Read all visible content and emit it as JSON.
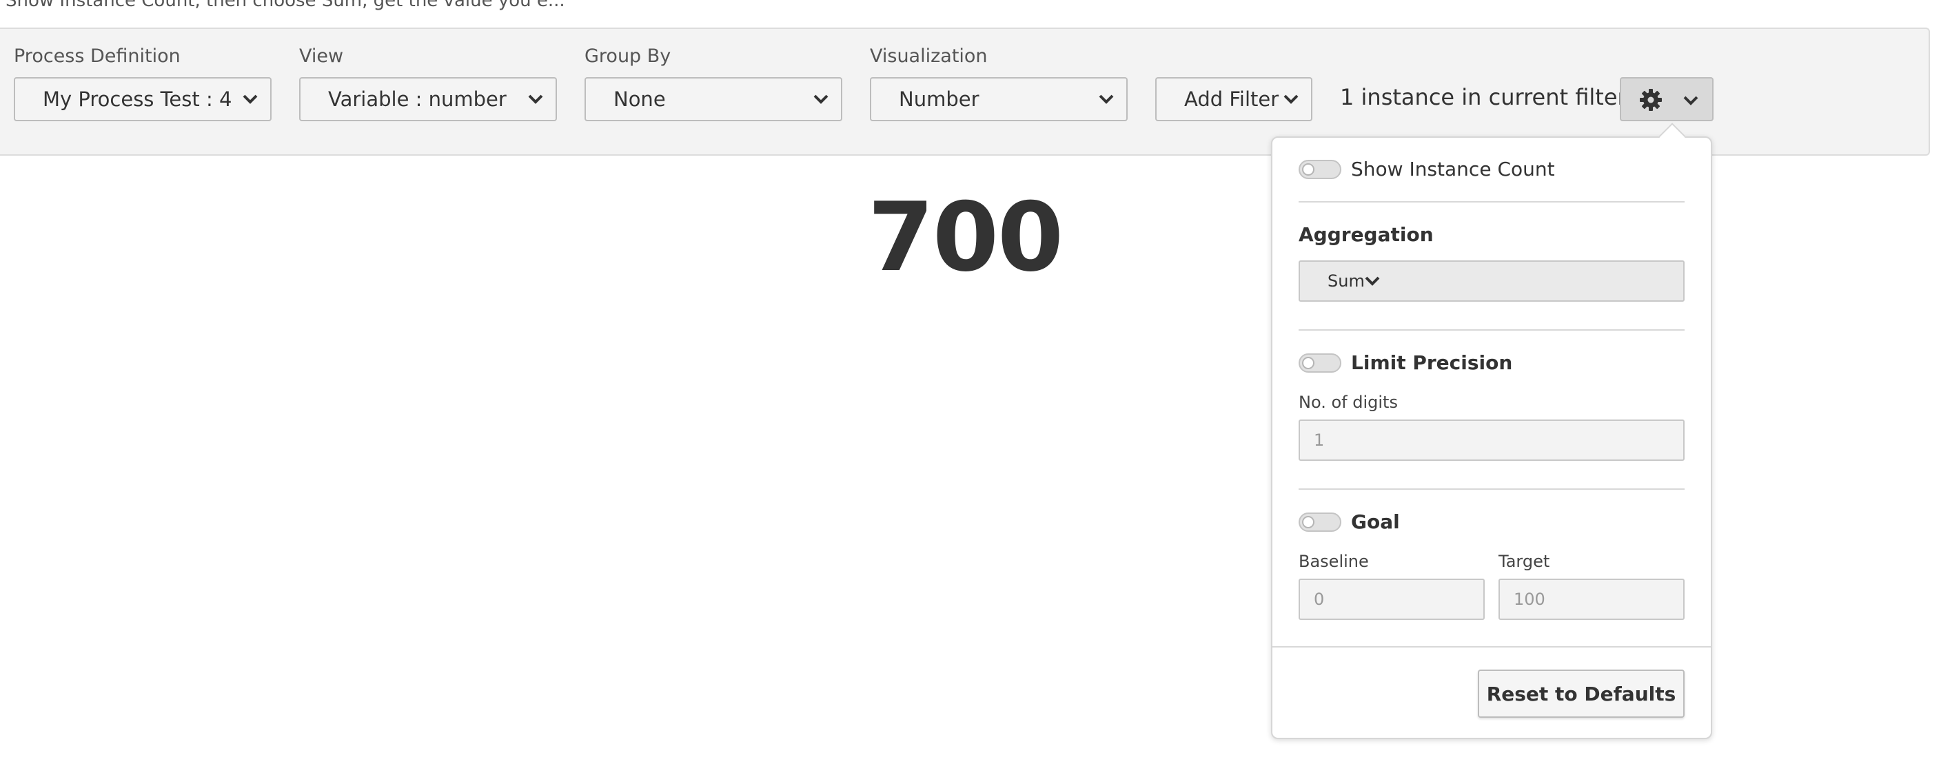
{
  "header": {
    "cutoff_text": "Show Instance Count, then choose Sum, get the value you e..."
  },
  "controls": {
    "process_definition": {
      "label": "Process Definition",
      "value": "My Process Test : 4"
    },
    "view": {
      "label": "View",
      "value": "Variable : number"
    },
    "group_by": {
      "label": "Group By",
      "value": "None"
    },
    "visualization": {
      "label": "Visualization",
      "value": "Number"
    },
    "add_filter_label": "Add Filter",
    "instance_count_text": "1 instance in current filter"
  },
  "result": {
    "value": "700"
  },
  "settings_popover": {
    "show_instance_count_label": "Show Instance Count",
    "show_instance_count_on": false,
    "aggregation_heading": "Aggregation",
    "aggregation_value": "Sum",
    "limit_precision_label": "Limit Precision",
    "limit_precision_on": false,
    "digits_label": "No. of digits",
    "digits_placeholder": "1",
    "goal_label": "Goal",
    "goal_on": false,
    "baseline_label": "Baseline",
    "baseline_placeholder": "0",
    "target_label": "Target",
    "target_placeholder": "100",
    "reset_label": "Reset to Defaults"
  },
  "icons": {
    "settings": "gear-icon",
    "dropdown": "chevron-down-icon"
  }
}
